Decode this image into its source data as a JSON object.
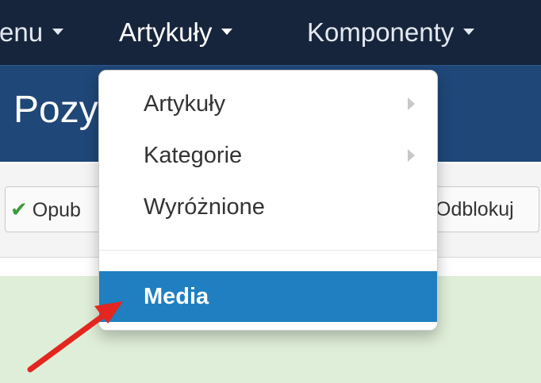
{
  "navbar": {
    "items": [
      {
        "label": "enu",
        "active": false
      },
      {
        "label": "Artykuły",
        "active": true
      },
      {
        "label": "Komponenty",
        "active": false
      }
    ]
  },
  "page": {
    "title": "Pozy"
  },
  "toolbar": {
    "publish_label": "Opub",
    "unlock_label": "Odblokuj"
  },
  "dropdown": {
    "items": [
      {
        "label": "Artykuły",
        "has_submenu": true
      },
      {
        "label": "Kategorie",
        "has_submenu": true
      },
      {
        "label": "Wyróżnione",
        "has_submenu": false
      }
    ],
    "highlighted_item": {
      "label": "Media"
    }
  },
  "colors": {
    "navbar_bg": "#17253c",
    "header_bg": "#1f4778",
    "highlight_bg": "#1f7fc0",
    "message_bg": "#dfeed8",
    "annotation_arrow": "#e3261f",
    "check_icon": "#3c9a3a"
  },
  "icons": {
    "nav_caret": "caret-down-icon",
    "submenu": "chevron-right-icon",
    "publish": "check-icon",
    "annotation": "red-arrow-icon"
  }
}
